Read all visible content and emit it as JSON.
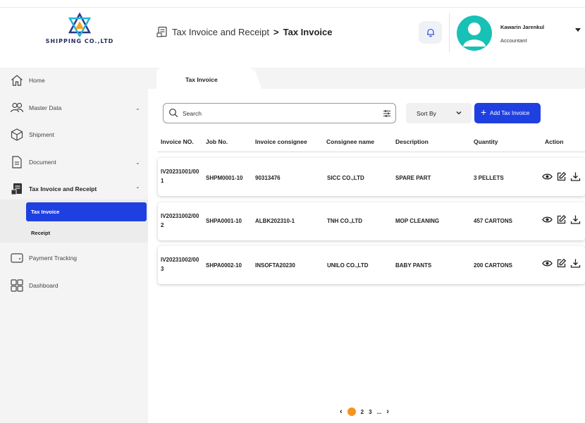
{
  "header": {
    "logo_text": "SHIPPING CO.,LTD",
    "breadcrumb_parent": "Tax Invoice and Receipt",
    "breadcrumb_separator": ">",
    "breadcrumb_current": "Tax Invoice",
    "user_name": "Kawarin Jarenkul",
    "user_role": "Accountant"
  },
  "sidebar": {
    "items": [
      {
        "label": "Home",
        "icon": "home-icon"
      },
      {
        "label": "Master Data",
        "icon": "users-icon",
        "caret": "⌄"
      },
      {
        "label": "Shipment",
        "icon": "box-icon"
      },
      {
        "label": "Document",
        "icon": "document-icon",
        "caret": "⌄"
      },
      {
        "label": "Tax Invoice and Receipt",
        "icon": "receipt-icon",
        "caret": "⌃"
      },
      {
        "label": "Payment Tracking",
        "icon": "wallet-icon"
      },
      {
        "label": "Dashboard",
        "icon": "dashboard-icon"
      }
    ],
    "submenu": [
      {
        "label": "Tax Invoice",
        "active": true
      },
      {
        "label": "Receipt",
        "active": false
      }
    ]
  },
  "main": {
    "tab_label": "Tax Invoice",
    "search_placeholder": "Search",
    "sort_label": "Sort By",
    "add_button_label": "Add Tax Invoice",
    "columns": [
      "Invoice NO.",
      "Job No.",
      "Invoice consignee",
      "Consignee name",
      "Description",
      "Quantity",
      "Action"
    ],
    "rows": [
      {
        "invoice_no": "IV20231001/001",
        "job_no": "SHPM0001-10",
        "invoice_consignee": "90313476",
        "consignee_name": "SICC CO.,LTD",
        "description": "SPARE PART",
        "quantity": "3 PELLETS"
      },
      {
        "invoice_no": "IV20231002/002",
        "job_no": "SHPA0001-10",
        "invoice_consignee": "ALBK202310-1",
        "consignee_name": "TNH CO.,LTD",
        "description": "MOP CLEANING",
        "quantity": "457 CARTONS"
      },
      {
        "invoice_no": "IV20231002/003",
        "job_no": "SHPA0002-10",
        "invoice_consignee": "INSOFTA20230",
        "consignee_name": "UNILO CO.,LTD",
        "description": "BABY PANTS",
        "quantity": "200 CARTONS"
      }
    ],
    "pagination": {
      "prev": "‹",
      "pages": [
        "1",
        "2",
        "3",
        "..."
      ],
      "current": "1",
      "next": "›"
    }
  },
  "colors": {
    "primary_blue": "#1f40e0",
    "avatar_teal": "#18c1b6",
    "page_orange": "#f7941d",
    "sidebar_bg": "#f4f4f4"
  }
}
